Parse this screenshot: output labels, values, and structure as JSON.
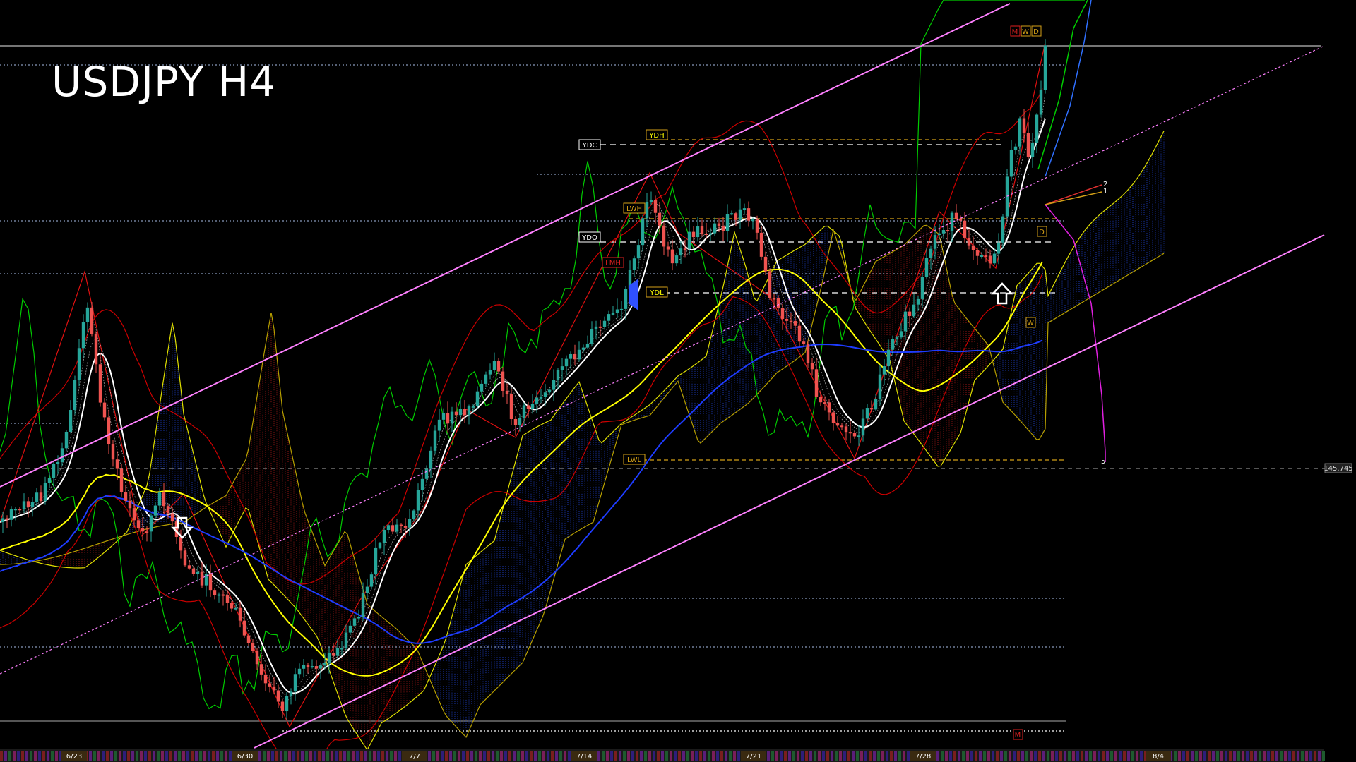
{
  "chart_data": {
    "type": "candlestick",
    "title": "USDJPY H4",
    "symbol": "USDJPY",
    "timeframe": "H4",
    "x_tick_labels": [
      "6/23",
      "6/30",
      "7/7",
      "7/14",
      "7/21",
      "7/28",
      "8/4"
    ],
    "price_label": "145.745",
    "level_tags": [
      "YDC",
      "YDH",
      "YDO",
      "YDL",
      "LWH",
      "LMH",
      "LWL"
    ],
    "period_tags": [
      "M",
      "W",
      "D"
    ],
    "projection_labels": [
      "2",
      "1",
      "5"
    ],
    "arrows": [
      {
        "direction": "down",
        "near": "6/26"
      },
      {
        "direction": "up",
        "near": "7/31"
      }
    ],
    "indicators": [
      "Ichimoku cloud",
      "Bollinger bands",
      "moving averages",
      "channel lines"
    ],
    "grid": false,
    "colors": {
      "background": "#000000",
      "bull_candle": "#26a69a",
      "bear_candle": "#ef5350",
      "channel": "#ff80ff",
      "ma_white": "#ffffff",
      "ma_yellow": "#ffff00",
      "ma_blue": "#1e3cff",
      "green_line": "#00cc00",
      "bollinger": "#cc0000",
      "cloud_bull": "#1e40c8",
      "cloud_bear": "#a01818"
    }
  }
}
